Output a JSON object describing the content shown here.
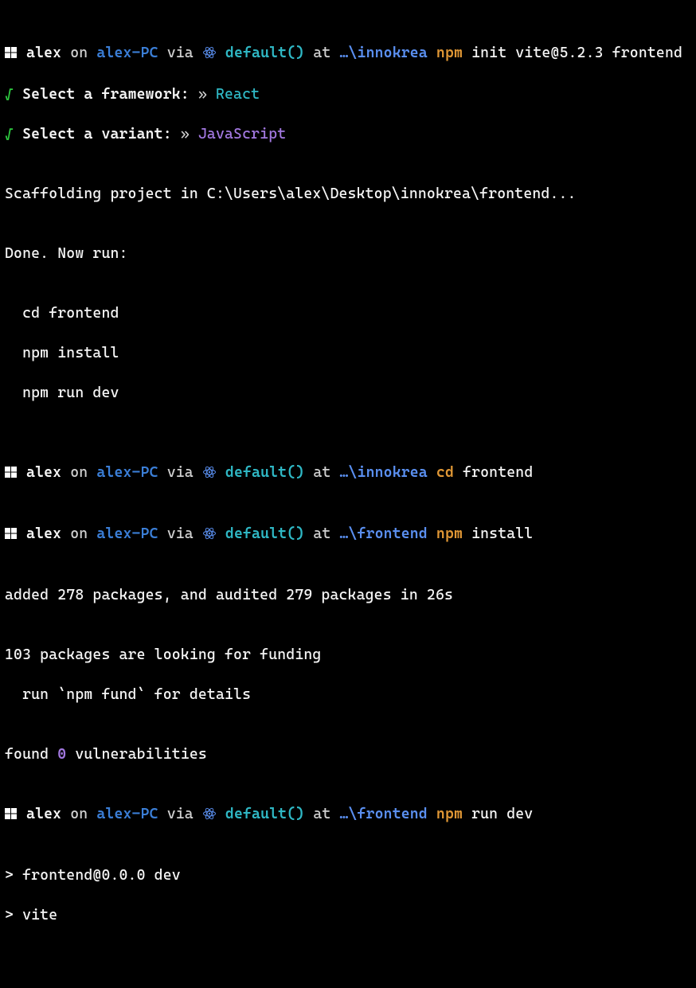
{
  "ps": {
    "user": "alex",
    "on": " on ",
    "host": "alex-PC",
    "via": " via ",
    "default": "default()",
    "at": " at "
  },
  "lines": {
    "l1": {
      "path": "…\\innokrea",
      "cmd": "npm",
      "args": " init vite@5.2.3 frontend"
    },
    "l2": {
      "check": "√",
      "prompt": " Select a framework:",
      "sep": " » ",
      "choice": "React"
    },
    "l3": {
      "check": "√",
      "prompt": " Select a variant:",
      "sep": " » ",
      "choice": "JavaScript"
    },
    "l4": "",
    "l5": "Scaffolding project in C:\\Users\\alex\\Desktop\\innokrea\\frontend...",
    "l6": "",
    "l7": "Done. Now run:",
    "l8": "",
    "l9": "  cd frontend",
    "l10": "  npm install",
    "l11": "  npm run dev",
    "l12": "",
    "l13": "",
    "l14": {
      "path": "…\\innokrea",
      "cmd": "cd",
      "args": " frontend"
    },
    "l15": "",
    "l16": {
      "path": "…\\frontend",
      "cmd": "npm",
      "args": " install"
    },
    "l17": "",
    "l18": "added 278 packages, and audited 279 packages in 26s",
    "l19": "",
    "l20": "103 packages are looking for funding",
    "l21": "  run `npm fund` for details",
    "l22": "",
    "l23a": "found ",
    "l23b": "0",
    "l23c": " vulnerabilities",
    "l24": "",
    "l25": {
      "path": "…\\frontend",
      "cmd": "npm",
      "args": " run dev"
    },
    "l26": "",
    "l27": "> frontend@0.0.0 dev",
    "l28": "> vite"
  }
}
